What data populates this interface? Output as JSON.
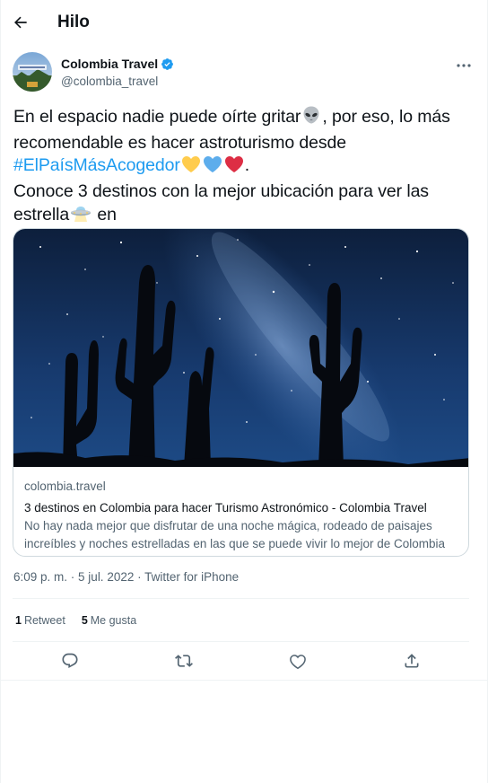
{
  "header": {
    "title": "Hilo"
  },
  "author": {
    "name": "Colombia Travel",
    "handle": "@colombia_travel"
  },
  "tweet": {
    "line1": "En el espacio nadie puede oírte gritar",
    "line1_after": ", por eso, lo más recomendable es hacer astroturismo desde ",
    "hashtag": "#ElPaísMásAcogedor",
    "after_hearts": ".",
    "line2": "Conoce 3 destinos con la mejor ubicación para ver las estrella",
    "line2_after": " en",
    "emojis": [
      "alien",
      "yellow-heart",
      "blue-heart",
      "red-heart",
      "ufo"
    ]
  },
  "card": {
    "domain": "colombia.travel",
    "title": "3 destinos en Colombia para hacer Turismo Astronómico - Colombia Travel",
    "description": "No hay nada mejor que disfrutar de una noche mágica, rodeado de paisajes increíbles y noches estrelladas en las que se puede vivir lo mejor de Colombia y…"
  },
  "meta": {
    "time": "6:09 p. m.",
    "separator": " · ",
    "date": "5 jul. 2022",
    "source": "Twitter for iPhone"
  },
  "stats": {
    "retweets_count": "1",
    "retweets_label": "Retweet",
    "likes_count": "5",
    "likes_label": "Me gusta"
  },
  "colors": {
    "accent": "#1d9bf0",
    "text": "#0f1419",
    "secondary": "#536471",
    "border": "#cfd9de"
  }
}
